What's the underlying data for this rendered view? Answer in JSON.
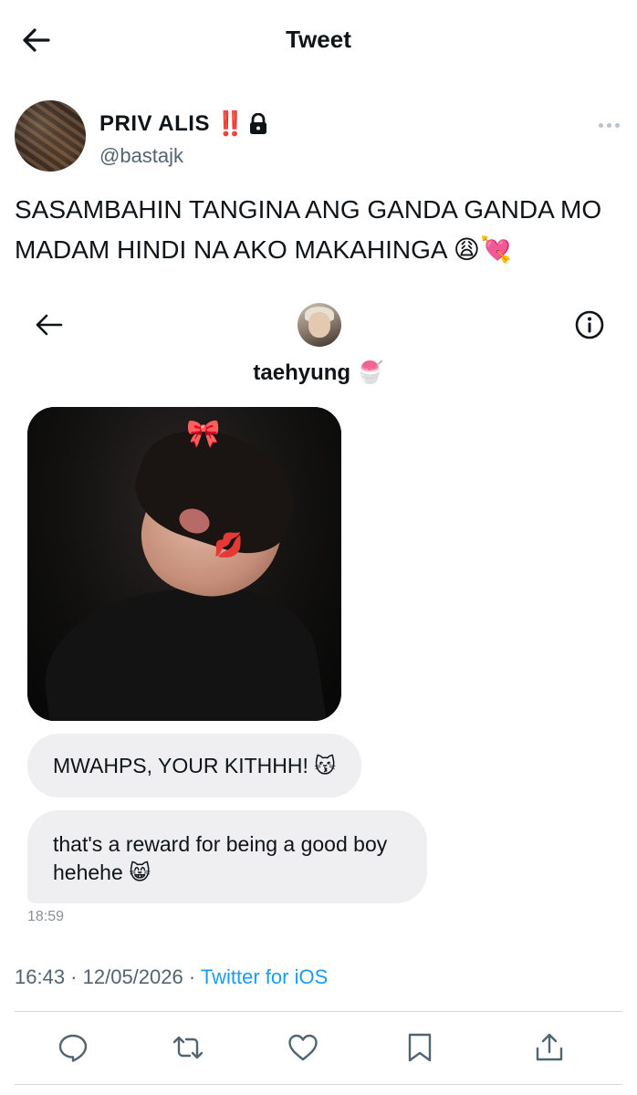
{
  "header": {
    "title": "Tweet",
    "back_icon": "arrow-left-icon"
  },
  "author": {
    "display_name": "PRIV ALIS",
    "emphasis": "‼️",
    "lock_icon": "lock-icon",
    "handle": "@bastajk",
    "more_icon": "more-dots-icon"
  },
  "tweet": {
    "text": "SASAMBAHIN TANGINA ANG GANDA GANDA MO MADAM HINDI NA AKO MAKAHINGA 😩💘"
  },
  "dm_screenshot": {
    "contact_name": "taehyung 🍧",
    "back_icon": "arrow-left-icon",
    "info_icon": "info-icon",
    "photo_stickers": {
      "bow": "🎀",
      "kiss": "💋"
    },
    "messages": [
      "MWAHPS, YOUR KITHHH! 😽",
      "that's a reward for being a good boy hehehe 😸"
    ],
    "timestamp": "18:59"
  },
  "meta": {
    "time": "16:43",
    "separator": " · ",
    "date": "12/05/2026",
    "source": "Twitter for iOS"
  },
  "actions": {
    "icons": [
      "reply-icon",
      "retweet-icon",
      "like-icon",
      "bookmark-icon",
      "share-icon"
    ]
  },
  "colors": {
    "accent": "#1d9bf0",
    "text": "#0f1419",
    "secondary_text": "#536471",
    "bubble": "#efeff1",
    "emphasis_red": "#e0162b"
  }
}
